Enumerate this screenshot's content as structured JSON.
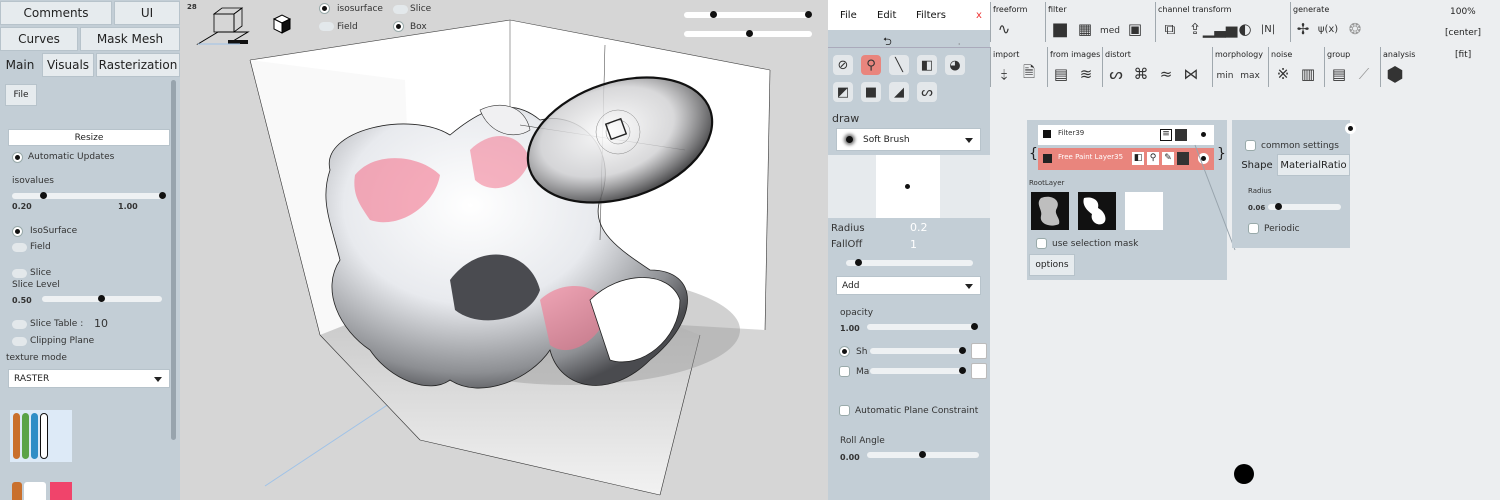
{
  "left_panel": {
    "tabs_top": [
      "Comments",
      "UI"
    ],
    "tabs_mid": [
      "Curves",
      "Mask Mesh"
    ],
    "tabs_main": [
      "Main",
      "Visuals",
      "Rasterization"
    ],
    "file_label": "File",
    "resize_label": "Resize",
    "auto_updates": "Automatic Updates",
    "isovalues": "isovalues",
    "iso_min": "0.20",
    "iso_max": "1.00",
    "isosurface": "IsoSurface",
    "field": "Field",
    "slice": "Slice",
    "slice_level": "Slice Level",
    "slice_level_val": "0.50",
    "slice_table": "Slice Table :",
    "slice_table_val": "10",
    "clipping": "Clipping Plane",
    "texture_mode": "texture mode",
    "texture_value": "RASTER",
    "swatch_colors": [
      "#c9702d",
      "#5aa347",
      "#2f8ec6",
      "#ffffff"
    ],
    "bottom_colors": [
      "#c9702d",
      "#ffffff",
      "#f0446b"
    ]
  },
  "viewport": {
    "fps": "28",
    "opt_isosurface": "isosurface",
    "opt_slice": "Slice",
    "opt_field": "Field",
    "opt_box": "Box",
    "slider1": 0.23,
    "slider2": 0.5,
    "highlight_color": "#f3778f"
  },
  "mid_panel": {
    "menu": [
      "File",
      "Edit",
      "Filters"
    ],
    "close": "x",
    "draw_label": "draw",
    "brush_name": "Soft Brush",
    "radius_label": "Radius",
    "radius_val": "0.2",
    "falloff_label": "FallOff",
    "falloff_val": "1",
    "blend_mode": "Add",
    "opacity_label": "opacity",
    "opacity_val": "1.00",
    "sh_label": "Sh",
    "ma_label": "Ma",
    "plane_constraint": "Automatic Plane Constraint",
    "roll_angle": "Roll Angle",
    "roll_val": "0.00"
  },
  "right_panel": {
    "sections": [
      "freeform",
      "filter",
      "channel transform",
      "generate",
      "import",
      "from images",
      "distort",
      "morphology",
      "noise",
      "group",
      "analysis"
    ],
    "zoom": "100%",
    "center": "[center]",
    "fit": "[fit]",
    "med_label": "med",
    "min_label": "min",
    "max_label": "max",
    "nl_label": "|N|",
    "psi_label": "ψ(x)",
    "node_filter": "Filter39",
    "node_layer": "Free Paint Layer35",
    "root_layer": "RootLayer",
    "use_selection_mask": "use selection mask",
    "options": "options",
    "common_settings": "common settings",
    "tab_shape": "Shape",
    "tab_material": "MaterialRatio",
    "radius_label": "Radius",
    "radius_val": "0.06",
    "periodic": "Periodic",
    "accent": "#e9857d"
  }
}
